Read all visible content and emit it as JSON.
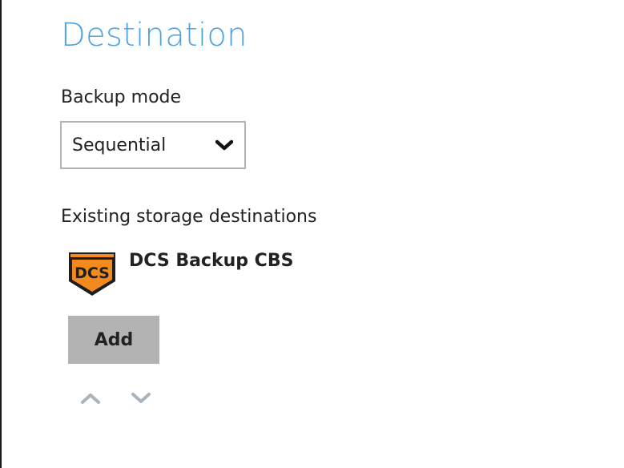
{
  "page": {
    "title": "Destination"
  },
  "backup_mode": {
    "label": "Backup mode",
    "selected": "Sequential"
  },
  "storage": {
    "label": "Existing storage destinations",
    "items": [
      {
        "name": "DCS Backup CBS",
        "logo_text": "DCS",
        "icon": "dcs-shield-logo"
      }
    ]
  },
  "actions": {
    "add_label": "Add",
    "move_up_icon": "chevron-up-icon",
    "move_down_icon": "chevron-down-icon"
  },
  "colors": {
    "title": "#4da3dc",
    "button_bg": "#b3b3b3",
    "select_border": "#b3b3b3",
    "logo_orange": "#f28a1e",
    "logo_dark": "#1e1e1e",
    "arrow": "#a9b4bd"
  }
}
